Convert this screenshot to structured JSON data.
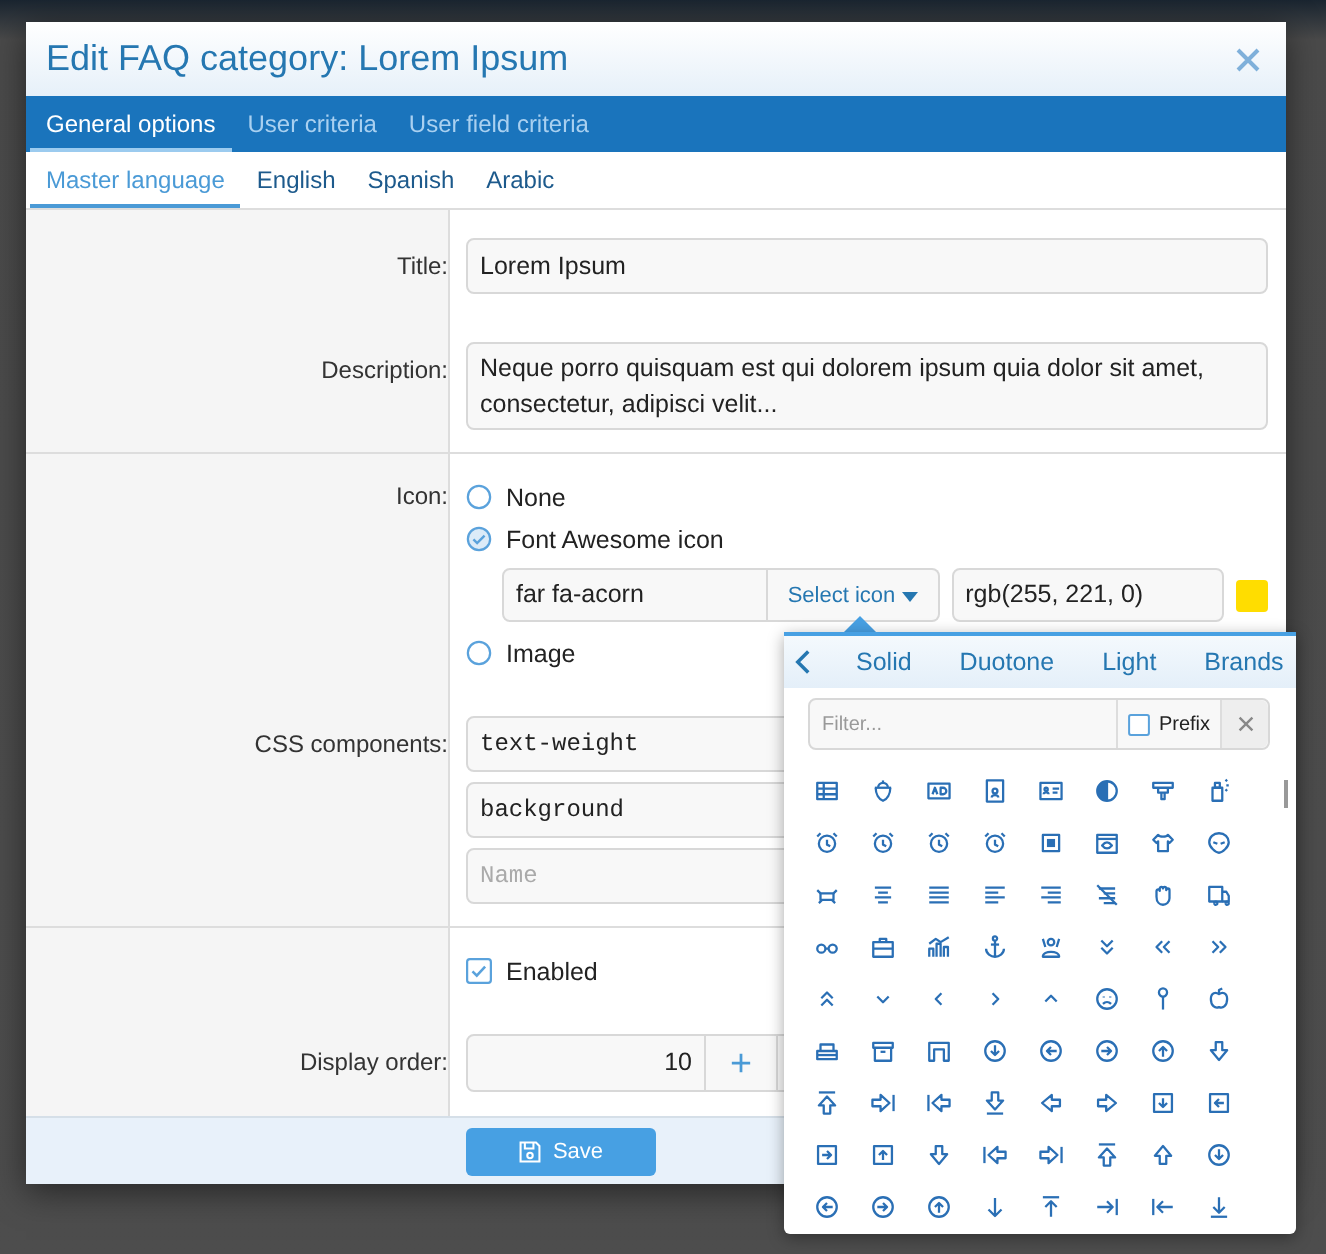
{
  "window": {
    "title": "Edit FAQ category: Lorem Ipsum"
  },
  "tabs": [
    {
      "label": "General options",
      "selected": true
    },
    {
      "label": "User criteria",
      "selected": false
    },
    {
      "label": "User field criteria",
      "selected": false
    }
  ],
  "language_tabs": [
    {
      "label": "Master language",
      "selected": true
    },
    {
      "label": "English",
      "selected": false
    },
    {
      "label": "Spanish",
      "selected": false
    },
    {
      "label": "Arabic",
      "selected": false
    }
  ],
  "title_field": {
    "label": "Title:",
    "value": "Lorem Ipsum"
  },
  "description_field": {
    "label": "Description:",
    "value": "Neque porro quisquam est qui dolorem ipsum quia dolor sit amet, consectetur, adipisci velit..."
  },
  "icon_field": {
    "label": "Icon:",
    "options": [
      {
        "kind": "none",
        "label": "None",
        "selected": false
      },
      {
        "kind": "font_awesome",
        "label": "Font Awesome icon",
        "selected": true
      },
      {
        "kind": "image",
        "label": "Image",
        "selected": false
      }
    ],
    "icon_class": "far fa-acorn",
    "select_button": "Select icon",
    "color_value": "rgb(255, 221, 0)",
    "color": "#ffdd00"
  },
  "css_components": {
    "label": "CSS components:",
    "values": [
      "text-weight",
      "background"
    ],
    "placeholder": "Name"
  },
  "enabled": {
    "label": "Enabled",
    "checked": true
  },
  "display_order": {
    "label": "Display order:",
    "value": "10"
  },
  "save_button": "Save",
  "icon_picker": {
    "style_tabs": [
      "Solid",
      "Duotone",
      "Light",
      "Brands"
    ],
    "filter_placeholder": "Filter...",
    "prefix": {
      "label": "Prefix",
      "checked": false
    }
  }
}
